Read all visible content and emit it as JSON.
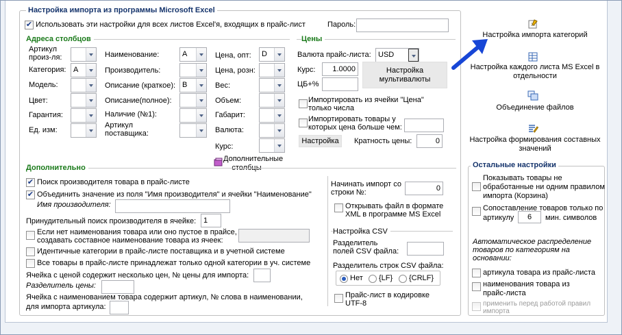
{
  "main": {
    "title": "Настройка импорта из программы Microsoft Excel",
    "use_all_sheets": "Использовать эти настройки для всех листов Excel'я, входящих в прайс-лист",
    "password_label": "Пароль:",
    "password_value": ""
  },
  "columns": {
    "title": "Адреса столбцов",
    "article_label": "Артикул\nпроиз-ля:",
    "category_label": "Категория:",
    "category_value": "A",
    "model_label": "Модель:",
    "color_label": "Цвет:",
    "warranty_label": "Гарантия:",
    "unit_label": "Ед. изм:",
    "name_label": "Наименование:",
    "name_value": "A",
    "manufacturer_label": "Производитель:",
    "desc_short_label": "Описание (краткое):",
    "desc_short_value": "B",
    "desc_full_label": "Описание(полное):",
    "stock_label": "Наличие (№1):",
    "supplier_article_label": "Артикул\nпоставщика:",
    "price_opt_label": "Цена, опт:",
    "price_opt_value": "D",
    "price_retail_label": "Цена, розн:",
    "weight_label": "Вес:",
    "volume_label": "Объем:",
    "size_label": "Габарит:",
    "currency_label": "Валюта:",
    "rate_label": "Курс:",
    "extra_columns": "Дополнительные\nстолбцы"
  },
  "prices": {
    "title": "Цены",
    "currency_label": "Валюта прайс-листа:",
    "currency_value": "USD",
    "rate_label": "Курс:",
    "rate_value": "1.0000",
    "cb_label": "ЦБ+%",
    "cb_value": "",
    "multicurrency_button": "Настройка\nмультивалюты",
    "import_numbers": "Импортировать из ячейки \"Цена\"\nтолько числа",
    "import_over": "Импортировать товары у\nкоторых цена больше чем:",
    "settings_button": "Настройка",
    "multiplicity_label": "Кратность цены:",
    "multiplicity_value": "0"
  },
  "extra": {
    "title": "Дополнительно",
    "search_manufacturer": "Поиск производителя товара в прайс-листе",
    "merge_fields": "Объединить значение из поля \"Имя производителя\" и ячейки \"Наименование\"",
    "manufacturer_name_label": "Имя производителя:",
    "forced_search_label": "Принудительный поиск производителя в ячейке:",
    "forced_search_value": "1",
    "compose_name": "Если нет наименования товара или оно пустое в прайсе,\nсоздавать составное наименование товара из ячеек:",
    "identical_categories": "Идентичные категории в прайс-листе поставщика и в учетной системе",
    "one_category": "Все товары в прайс-листе принадлежат только одной категории в уч. системе",
    "several_prices_label": "Ячейка с ценой содержит несколько цен, № цены для импорта:",
    "price_separator_label": "Разделитель цены:",
    "article_in_name_label": "Ячейка с наименованием товара содержит артикул, № слова в наименовании,\nдля импорта артикула:",
    "start_row_label": "Начинать импорт со\nстроки №:",
    "start_row_value": "0",
    "open_in_excel": "Открывать файл в формате\nXML в программе MS Excel"
  },
  "csv": {
    "title": "Настройка CSV",
    "field_sep_label": "Разделитель\nполей CSV файла:",
    "row_sep_label": "Разделитель строк CSV файла:",
    "opt_none": "Нет",
    "opt_lf": "{LF}",
    "opt_crlf": "{CRLF}",
    "utf8": "Прайс-лист в кодировке\nUTF-8"
  },
  "links": {
    "category_import": "Настройка импорта категорий",
    "each_sheet": "Настройка каждого листа MS Excel в\nотдельности",
    "merge_files": "Объединение файлов",
    "composite_values": "Настройка формирования составных\nзначений"
  },
  "other": {
    "title": "Остальные настройки",
    "show_unprocessed": "Показывать товары не\nобработанные ни одним правилом\nимпорта (Корзина)",
    "match_article": "Сопоставление товаров только по\nартикулу",
    "min_chars_value": "6",
    "min_chars_label": "мин. символов",
    "auto_dist_label": "Автоматическое распределение\nтоваров по категориям на\nосновании:",
    "by_article": "артикула товара из прайс-листа",
    "by_name": "наименования товара из\nпрайс-листа",
    "apply_before": "применить перед работой правил\nимпорта"
  },
  "colors": {
    "accent": "#14336b",
    "section": "#1a7a1a",
    "arrow": "#1746d6"
  }
}
